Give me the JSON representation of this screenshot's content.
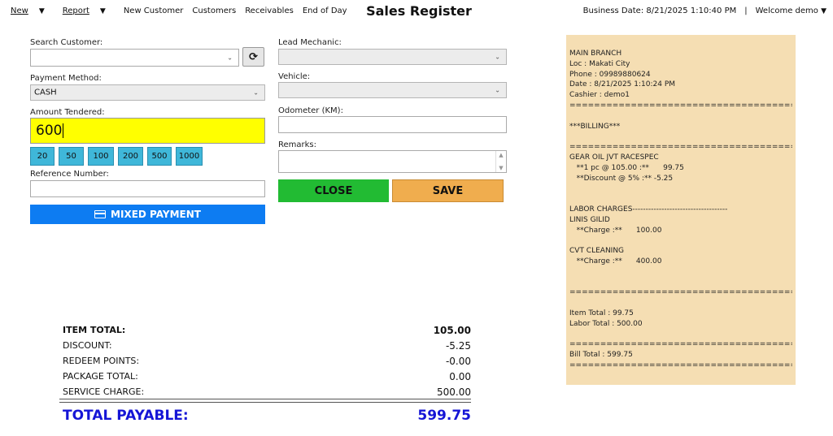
{
  "menu": {
    "new": "New",
    "report": "Report",
    "new_customer": "New Customer",
    "customers": "Customers",
    "receivables": "Receivables",
    "end_of_day": "End of Day"
  },
  "title": "Sales Register",
  "header": {
    "business_date": "Business Date: 8/21/2025 1:10:40 PM",
    "welcome": "Welcome demo"
  },
  "form": {
    "search_customer_label": "Search Customer:",
    "search_customer_value": "",
    "payment_method_label": "Payment Method:",
    "payment_method_value": "CASH",
    "amount_tendered_label": "Amount Tendered:",
    "amount_tendered_value": "600",
    "quick_amounts": [
      "20",
      "50",
      "100",
      "200",
      "500",
      "1000"
    ],
    "reference_number_label": "Reference Number:",
    "reference_number_value": "",
    "mixed_payment_label": "MIXED PAYMENT",
    "lead_mechanic_label": "Lead Mechanic:",
    "lead_mechanic_value": "",
    "vehicle_label": "Vehicle:",
    "vehicle_value": "",
    "odometer_label": "Odometer (KM):",
    "odometer_value": "",
    "remarks_label": "Remarks:",
    "remarks_value": "",
    "close_label": "CLOSE",
    "save_label": "SAVE"
  },
  "totals": {
    "rows": [
      {
        "label": "ITEM TOTAL:",
        "value": "105.00",
        "bold": true
      },
      {
        "label": "DISCOUNT:",
        "value": "-5.25"
      },
      {
        "label": "REDEEM POINTS:",
        "value": "-0.00"
      },
      {
        "label": "PACKAGE TOTAL:",
        "value": "0.00"
      },
      {
        "label": "SERVICE CHARGE:",
        "value": "500.00"
      }
    ],
    "payable_label": "TOTAL PAYABLE:",
    "payable_value": "599.75"
  },
  "receipt": {
    "lines": [
      "MAIN BRANCH",
      "Loc : Makati City",
      "Phone : 09989880624",
      "Date : 8/21/2025 1:10:24 PM",
      "Cashier : demo1",
      "=====================================",
      "",
      "***BILLING***",
      "",
      "=====================================",
      "GEAR OIL JVT RACESPEC",
      "   **1 pc @ 105.00 :**      99.75",
      "   **Discount @ 5% :** -5.25",
      "",
      "",
      "LABOR CHARGES------------------------------------",
      "LINIS GILID",
      "   **Charge :**      100.00",
      "",
      "CVT CLEANING",
      "   **Charge :**      400.00",
      "",
      "",
      "=======================================",
      "",
      "Item Total : 99.75",
      "Labor Total : 500.00",
      "",
      "=======================================",
      "Bill Total : 599.75",
      "======================================="
    ]
  }
}
